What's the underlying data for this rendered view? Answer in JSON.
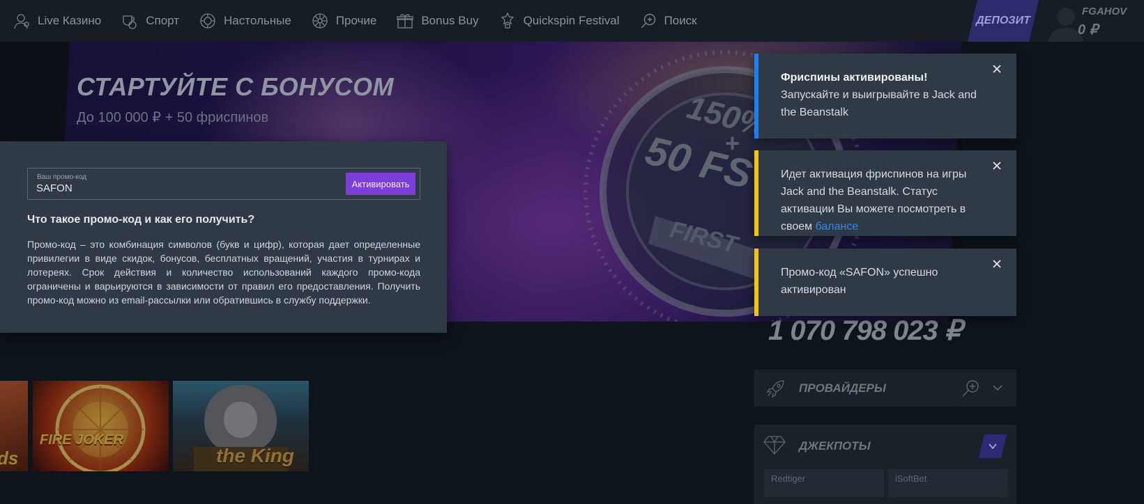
{
  "nav": {
    "items": [
      {
        "label": "Live Казино",
        "icon": "live-dealer-icon"
      },
      {
        "label": "Спорт",
        "icon": "soccer-ball-icon"
      },
      {
        "label": "Настольные",
        "icon": "poker-chip-icon"
      },
      {
        "label": "Прочие",
        "icon": "roulette-icon"
      },
      {
        "label": "Bonus Buy",
        "icon": "gift-icon"
      },
      {
        "label": "Quickspin Festival",
        "icon": "trophy-icon"
      },
      {
        "label": "Поиск",
        "icon": "search-icon"
      }
    ]
  },
  "account": {
    "deposit_label": "ДЕПОЗИТ",
    "username": "FGAHOV",
    "balance": "0 ₽"
  },
  "banner": {
    "title": "СТАРТУЙТЕ С БОНУСОМ",
    "subtitle": "До 100 000 ₽ + 50 фриспинов",
    "art_text": [
      "150%",
      "+",
      "50 FS",
      "FIRST"
    ]
  },
  "promo": {
    "field_label": "Ваш промо-код",
    "field_value": "SAFON",
    "button_label": "Активировать",
    "question": "Что такое промо-код и как его получить?",
    "description": "Промо-код – это комбинация символов (букв и цифр), которая дает определенные привилегии в виде скидок, бонусов, бесплатных вращений, участия в турнирах и лотереях. Срок действия и количество использований каждого промо-кода ограничены и варьируются в зависимости от правил его предоставления. Получить промо-код можно из email-рассылки или обратившись в службу поддержки."
  },
  "games": [
    {
      "title": "ds"
    },
    {
      "title": "FIRE JOKER"
    },
    {
      "title": "the King"
    }
  ],
  "jackpot_total": "1 070 798 023 ₽",
  "providers": {
    "title": "ПРОВАЙДЕРЫ"
  },
  "jackpots": {
    "title": "ДЖЕКПОТЫ",
    "tabs": [
      "Redtiger",
      "iSoftBet"
    ]
  },
  "toasts": [
    {
      "title": "Фриспины активированы!",
      "text": "Запускайте и выигрывайте в Jack and the Beanstalk",
      "accent": "#1d7ff0"
    },
    {
      "text": "Идет активация фриспинов на игры Jack and the Beanstalk. Статус активации Вы можете посмотреть в своем",
      "link": "балансе",
      "accent": "#f2c21b"
    },
    {
      "text": "Промо-код «SAFON» успешно активирован",
      "accent": "#f2c21b"
    }
  ],
  "colors": {
    "accent_purple": "#7c3fd9",
    "link_blue": "#2f8bf0",
    "info_blue": "#1d7ff0",
    "warning_yellow": "#f2c21b"
  }
}
